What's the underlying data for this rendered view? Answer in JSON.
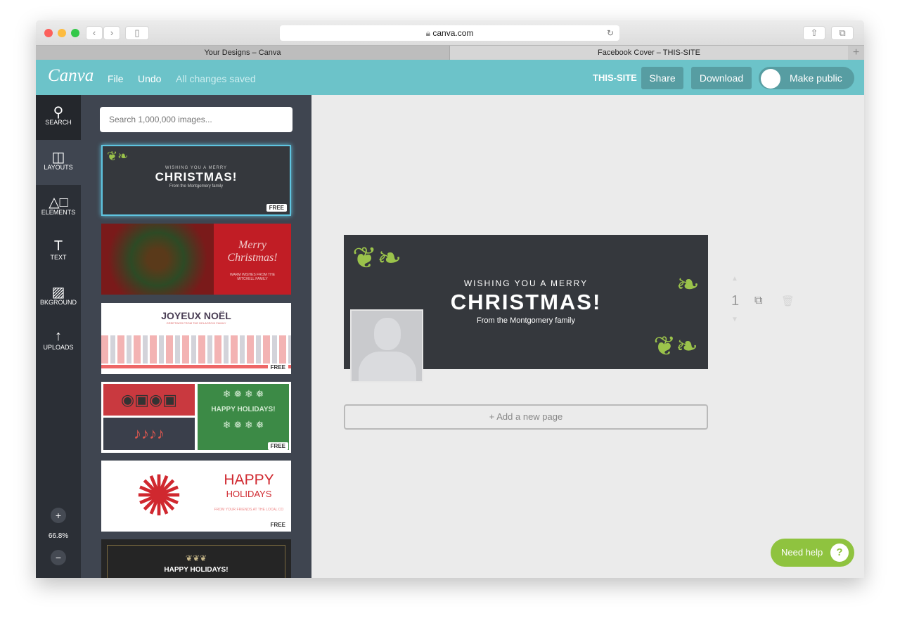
{
  "browser": {
    "url": "canva.com",
    "tabs": [
      "Your Designs – Canva",
      "Facebook Cover – THIS-SITE"
    ]
  },
  "toolbar": {
    "logo": "Canva",
    "file": "File",
    "undo": "Undo",
    "status": "All changes saved",
    "team": "THIS-SITE",
    "share": "Share",
    "download": "Download",
    "make_public": "Make public",
    "accent": "#6cc3c9"
  },
  "sidebar": {
    "items": [
      {
        "label": "SEARCH",
        "icon": "search-icon"
      },
      {
        "label": "LAYOUTS",
        "icon": "layouts-icon"
      },
      {
        "label": "ELEMENTS",
        "icon": "elements-icon"
      },
      {
        "label": "TEXT",
        "icon": "text-icon"
      },
      {
        "label": "BKGROUND",
        "icon": "background-icon"
      },
      {
        "label": "UPLOADS",
        "icon": "upload-icon"
      }
    ],
    "zoom": "66.8%",
    "zoom_in": "+",
    "zoom_out": "−"
  },
  "panel": {
    "search_placeholder": "Search 1,000,000 images...",
    "free": "FREE",
    "templates": [
      {
        "line1": "WISHING YOU A MERRY",
        "title": "CHRISTMAS!",
        "sub": "From the Montgomery family"
      },
      {
        "title": "Merry Christmas!",
        "sub": "WARM WISHES FROM THE MITCHELL FAMILY"
      },
      {
        "title": "JOYEUX NOËL",
        "sub": "GREETINGS FROM THE DELACROIX FAMILY"
      },
      {
        "title": "HAPPY HOLIDAYS!"
      },
      {
        "title": "HAPPY",
        "title2": "HOLIDAYS",
        "sub": "FROM YOUR FRIENDS AT THE LOCAL CO"
      },
      {
        "title": "HAPPY HOLIDAYS!"
      }
    ]
  },
  "design": {
    "line1": "WISHING YOU A MERRY",
    "title": "CHRISTMAS!",
    "sub": "From the Montgomery family",
    "page_number": "1",
    "add_page": "+ Add a new page"
  },
  "help": {
    "label": "Need help",
    "icon": "?"
  }
}
